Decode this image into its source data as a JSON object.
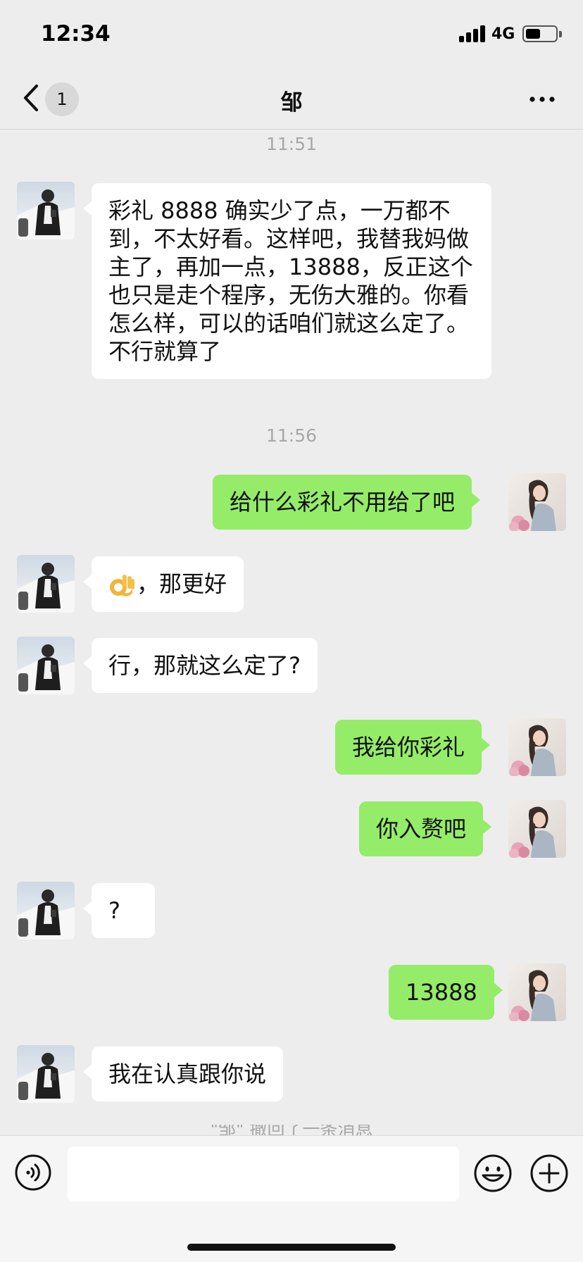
{
  "status_bar": {
    "time": "12:34",
    "network": "4G"
  },
  "nav": {
    "unread_count": "1",
    "title": "邹"
  },
  "colors": {
    "background": "#ededed",
    "incoming_bubble": "#ffffff",
    "outgoing_bubble": "#95ec69",
    "timestamp": "#a8a8a8"
  },
  "messages": {
    "ts1": "11:51",
    "m1": "彩礼 8888 确实少了点，一万都不到，不太好看。这样吧，我替我妈做主了，再加一点，13888，反正这个也只是走个程序，无伤大雅的。你看怎么样，可以的话咱们就这么定了。不行就算了",
    "ts2": "11:56",
    "m2": "给什么彩礼不用给了吧",
    "m3_emoji": "ok-hand",
    "m3": "，那更好",
    "m4": "行，那就这么定了?",
    "m5": "我给你彩礼",
    "m6": "你入赘吧",
    "m7": "?",
    "m8": "13888",
    "m9": "我在认真跟你说"
  },
  "recall_notice": "\"邹\" 撤回了一条消息",
  "input_bar": {
    "voice_icon": "voice-icon",
    "emoji_icon": "smiley-icon",
    "plus_icon": "plus-icon"
  }
}
